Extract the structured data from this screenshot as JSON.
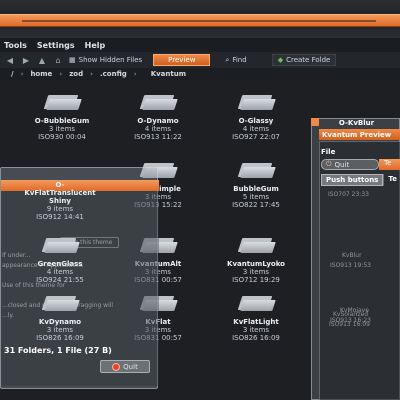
{
  "menubar": {
    "items": [
      "Tools",
      "Settings",
      "Help"
    ]
  },
  "toolbar": {
    "show_hidden": "Show Hidden Files",
    "preview": "Preview",
    "find": "Find",
    "create_folder": "Create Folde"
  },
  "path": {
    "crumbs": [
      "/",
      "home",
      "zod",
      ".config",
      "Kvantum"
    ]
  },
  "folders": [
    {
      "name": "O-BubbleGum",
      "count": "3 items",
      "date": "ISO930 00:04"
    },
    {
      "name": "O-Dynamo",
      "count": "4 items",
      "date": "ISO913 11:22"
    },
    {
      "name": "O-Glassy",
      "count": "4 items",
      "date": "ISO927 22:07"
    },
    {
      "name": "O-KvFlatTranslucent Shiny",
      "count": "9 items",
      "date": "ISO912 14:41"
    },
    {
      "name": "O-KvSimple",
      "count": "3 items",
      "date": "ISO913 15:22"
    },
    {
      "name": "BubbleGum",
      "count": "5 items",
      "date": "ISO822 17:45"
    },
    {
      "name": "GreenGlass",
      "count": "4 items",
      "date": "ISO924 21:55"
    },
    {
      "name": "KvantumAlt",
      "count": "3 items",
      "date": "ISO831 00:57"
    },
    {
      "name": "KvantumLyoko",
      "count": "3 items",
      "date": "ISO712 19:29"
    },
    {
      "name": "KvDynamo",
      "count": "3 items",
      "date": "ISO826 16:09"
    },
    {
      "name": "KvFlat",
      "count": "3 items",
      "date": "ISO831 00:57"
    },
    {
      "name": "KvFlatLight",
      "count": "3 items",
      "date": "ISO826 16:09"
    }
  ],
  "status": {
    "text": "31 Folders, 1 File (27 B)"
  },
  "left_dialog": {
    "quit": "Quit",
    "ghost_button": "Use this theme",
    "ghost_lines": [
      "If under...",
      "appearance > Applications",
      "Use of this theme for",
      "...closed and reopened, dragging will",
      "...ly."
    ]
  },
  "right_window": {
    "title": "O-KvBlur",
    "preview_tab": "Kvantum Preview",
    "file_menu": "File",
    "quit": "Quit",
    "chip": "Te",
    "tabs": [
      "Push buttons",
      "Te"
    ],
    "ghost_items": [
      {
        "name": "",
        "date": "ISO707 23:33"
      },
      {
        "name": "KvBlur",
        "date": "ISO913 19:53"
      },
      {
        "name": "KvMojave",
        "date": "ISO913 16:23"
      },
      {
        "name": "KvSolarized",
        "date": "ISO913 16:09"
      }
    ]
  },
  "colors": {
    "accent": "#e8743a",
    "background": "#1d1f23"
  }
}
